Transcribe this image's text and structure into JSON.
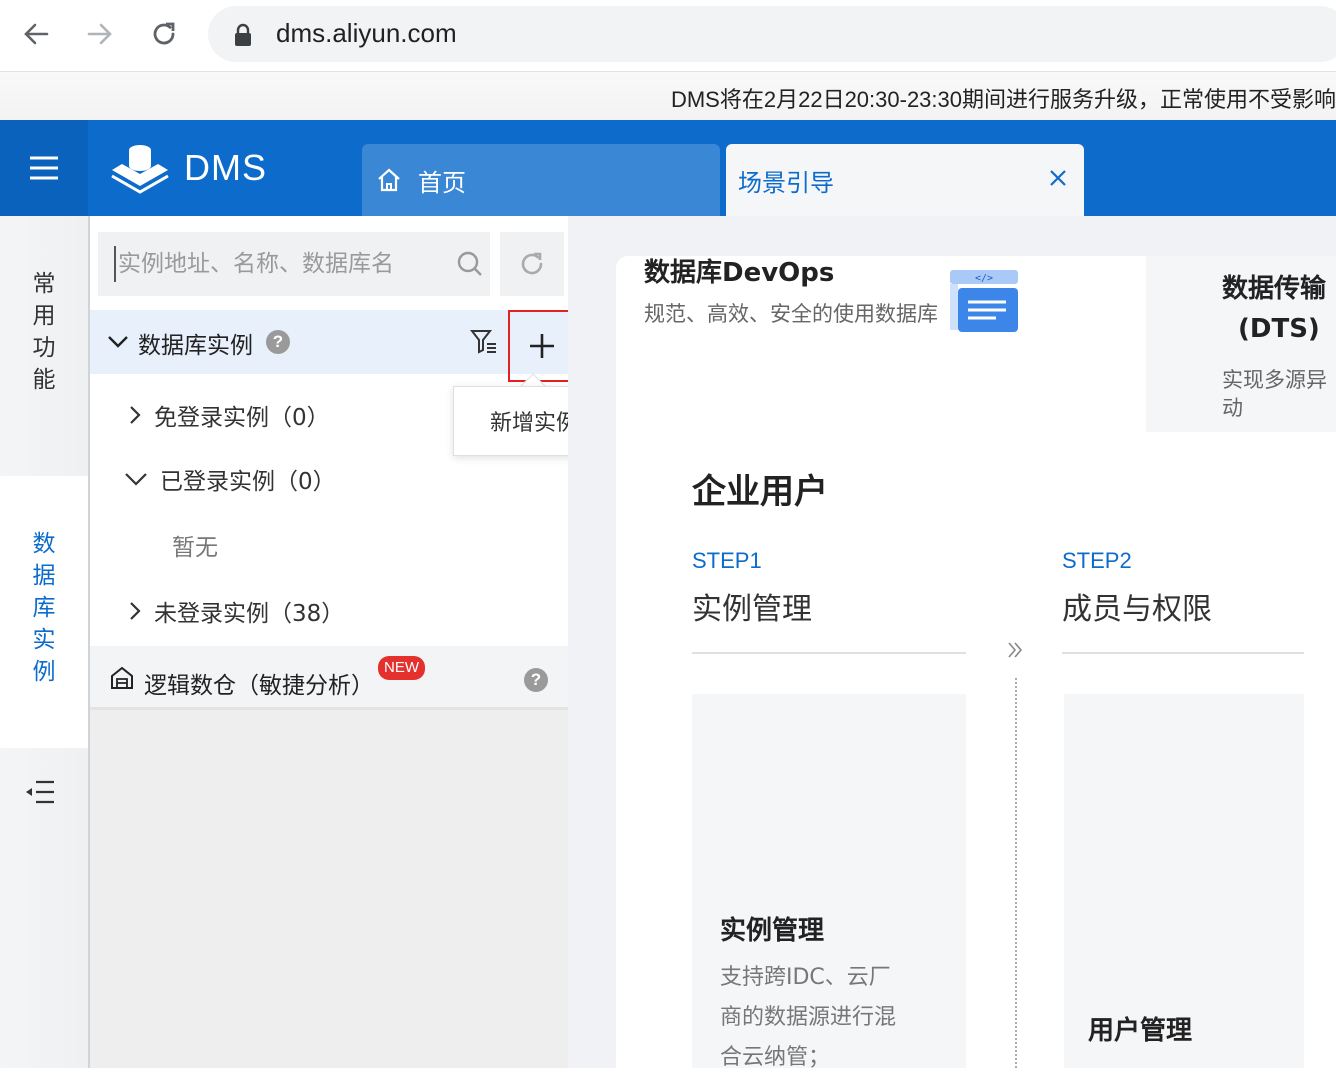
{
  "browser": {
    "url": "dms.aliyun.com"
  },
  "notice": {
    "text": "DMS将在2月22日20:30-23:30期间进行服务升级，正常使用不受影响"
  },
  "header": {
    "logo_text": "DMS",
    "tabs": [
      {
        "label": "首页"
      },
      {
        "label": "场景引导"
      }
    ]
  },
  "rail": {
    "common": [
      "常",
      "用",
      "功",
      "能"
    ],
    "db_instances": [
      "数",
      "据",
      "库",
      "实",
      "例"
    ]
  },
  "panel": {
    "search_placeholder": "实例地址、名称、数据库名",
    "db_section_title": "数据库实例",
    "tree": [
      {
        "label": "免登录实例（0）"
      },
      {
        "label": "已登录实例（0）"
      },
      {
        "label": "暂无"
      },
      {
        "label": "未登录实例（38）"
      }
    ],
    "logic": {
      "label": "逻辑数仓（敏捷分析）",
      "badge": "NEW"
    },
    "tooltip": "新增实例"
  },
  "main": {
    "devops": {
      "title": "数据库DevOps",
      "desc": "规范、高效、安全的使用数据库"
    },
    "dts": {
      "title": "数据传输",
      "sub": "(DTS)",
      "desc": "实现多源异动"
    },
    "section_title": "企业用户",
    "steps": [
      {
        "step": "STEP1",
        "name": "实例管理"
      },
      {
        "step": "STEP2",
        "name": "成员与权限"
      }
    ],
    "cards": [
      {
        "title": "实例管理",
        "desc": [
          "支持跨IDC、云厂",
          "商的数据源进行混",
          "合云纳管；"
        ]
      },
      {
        "title": "用户管理"
      }
    ]
  },
  "colors": {
    "brand": "#0d6ccb",
    "highlight_border": "#e32222",
    "new_badge": "#e5312e"
  }
}
